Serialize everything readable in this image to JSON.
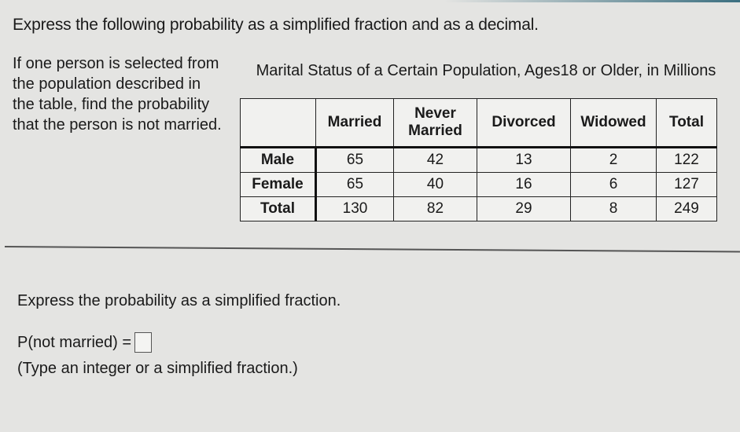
{
  "instruction": "Express the following probability as a simplified fraction and as a decimal.",
  "problem_text": "If one person is selected from the population described in the table, find the probability that the person is not married.",
  "table": {
    "caption": "Marital Status of a Certain Population, Ages18 or Older, in Millions",
    "columns": [
      "",
      "Married",
      "Never Married",
      "Divorced",
      "Widowed",
      "Total"
    ],
    "rows": [
      {
        "label": "Male",
        "values": [
          "65",
          "42",
          "13",
          "2",
          "122"
        ]
      },
      {
        "label": "Female",
        "values": [
          "65",
          "40",
          "16",
          "6",
          "127"
        ]
      },
      {
        "label": "Total",
        "values": [
          "130",
          "82",
          "29",
          "8",
          "249"
        ]
      }
    ]
  },
  "question": {
    "prompt": "Express the probability as a simplified fraction.",
    "answer_label": "P(not married) =",
    "answer_value": "",
    "hint": "(Type an integer or a simplified fraction.)"
  }
}
